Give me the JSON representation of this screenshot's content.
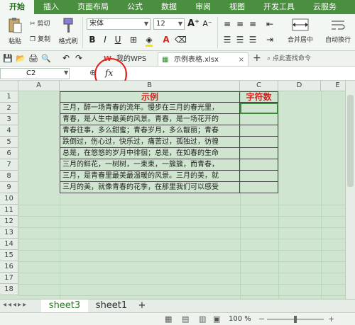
{
  "ribbon_tabs": [
    "开始",
    "插入",
    "页面布局",
    "公式",
    "数据",
    "审阅",
    "视图",
    "开发工具",
    "云服务"
  ],
  "clipboard": {
    "paste": "粘贴",
    "cut": "剪切",
    "copy": "复制",
    "format_painter": "格式刷"
  },
  "font": {
    "name": "宋体",
    "size": "12",
    "bold": "B",
    "italic": "I",
    "underline": "U",
    "font_color_glyph": "A"
  },
  "align": {
    "merge_center": "合并居中",
    "wrap_text": "自动换行"
  },
  "qat": {
    "wps_tab": "我的WPS",
    "file_tab": "示例表格.xlsx",
    "search_hint": "点此查找命令"
  },
  "formula_bar": {
    "cell_ref": "C2",
    "fx": "fx"
  },
  "columns": [
    "A",
    "B",
    "C",
    "D",
    "E"
  ],
  "rows": [
    "1",
    "2",
    "3",
    "4",
    "5",
    "6",
    "7",
    "8",
    "9",
    "10",
    "11",
    "12",
    "13",
    "14",
    "15",
    "16",
    "17",
    "18"
  ],
  "cells": {
    "b1": "示例",
    "c1": "字符数",
    "b_rows": [
      "三月，醉一场青春的流年。慢步在三月的春光里，",
      "青春，是人生中最美的风景。青春，是一场花开的",
      "青春往事，多么甜蜜；青春岁月，多么靓丽；青春",
      "跌倒过，伤心过，快乐过，痛苦过，孤独过，彷徨",
      "总是，在悠悠的岁月中徘徊；总是，在如春的生命",
      "三月的鲜花，一树树，一束束，一簇簇，而青春，",
      "三月，是青春里最美最温暖的风景。三月的美，就",
      "三月的美，就像青春的花季，在那里我们可以感受"
    ]
  },
  "sheets": [
    "sheet3",
    "sheet1",
    "+"
  ],
  "status": {
    "zoom": "100 %"
  },
  "colors": {
    "accent": "#4a8e3f",
    "highlight_red": "#e02020",
    "grid_bg": "#cfe5cf"
  }
}
